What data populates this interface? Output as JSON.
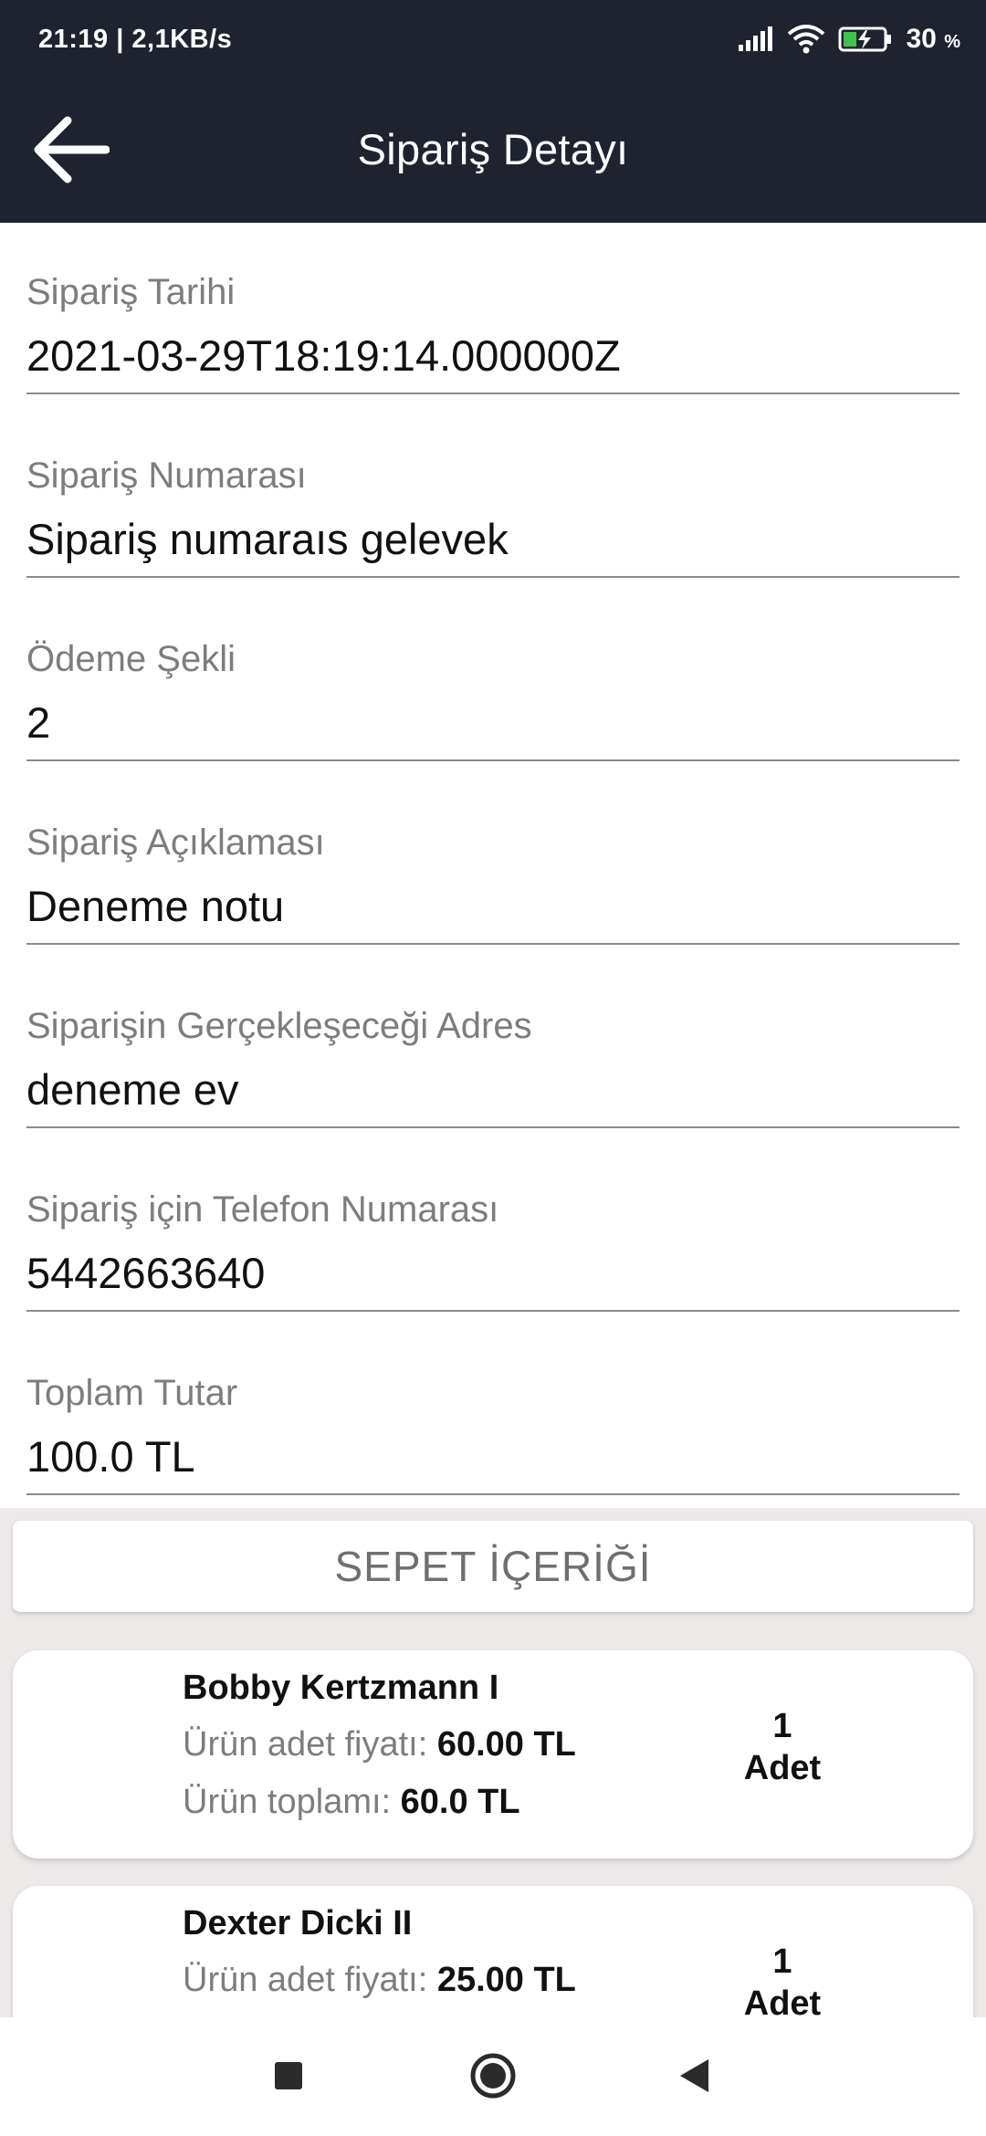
{
  "status_bar": {
    "time_speed": "21:19 | 2,1KB/s",
    "battery_percent": "30",
    "battery_unit": "%",
    "icons": [
      "signal-icon",
      "wifi-icon",
      "battery-charging-icon"
    ]
  },
  "app_bar": {
    "title": "Sipariş Detayı",
    "back_icon": "arrow-left-icon"
  },
  "fields": [
    {
      "label": "Sipariş Tarihi",
      "value": "2021-03-29T18:19:14.000000Z"
    },
    {
      "label": "Sipariş Numarası",
      "value": "Sipariş numaraıs gelevek"
    },
    {
      "label": "Ödeme Şekli",
      "value": "2"
    },
    {
      "label": "Sipariş Açıklaması",
      "value": "Deneme notu"
    },
    {
      "label": "Siparişin Gerçekleşeceği Adres",
      "value": "deneme ev"
    },
    {
      "label": "Sipariş için Telefon Numarası",
      "value": "5442663640"
    },
    {
      "label": "Toplam Tutar",
      "value": "100.0 TL"
    }
  ],
  "cart_button": {
    "label": "SEPET İÇERİĞİ"
  },
  "products": [
    {
      "name": "Bobby Kertzmann I",
      "unit_price_label": "Ürün adet fiyatı: ",
      "unit_price": "60.00 TL",
      "total_label": "Ürün toplamı: ",
      "total": "60.0 TL",
      "qty": "1",
      "qty_unit": "Adet"
    },
    {
      "name": "Dexter Dicki II",
      "unit_price_label": "Ürün adet fiyatı: ",
      "unit_price": "25.00 TL",
      "total_label": "",
      "total": "",
      "qty": "1",
      "qty_unit": "Adet"
    }
  ],
  "nav_bar": {
    "icons": [
      "recents-square-icon",
      "home-circle-icon",
      "back-triangle-icon"
    ]
  },
  "colors": {
    "header_bg": "#1f2330",
    "page_bg": "#ece9e8",
    "label_gray": "#7d7d7d"
  }
}
